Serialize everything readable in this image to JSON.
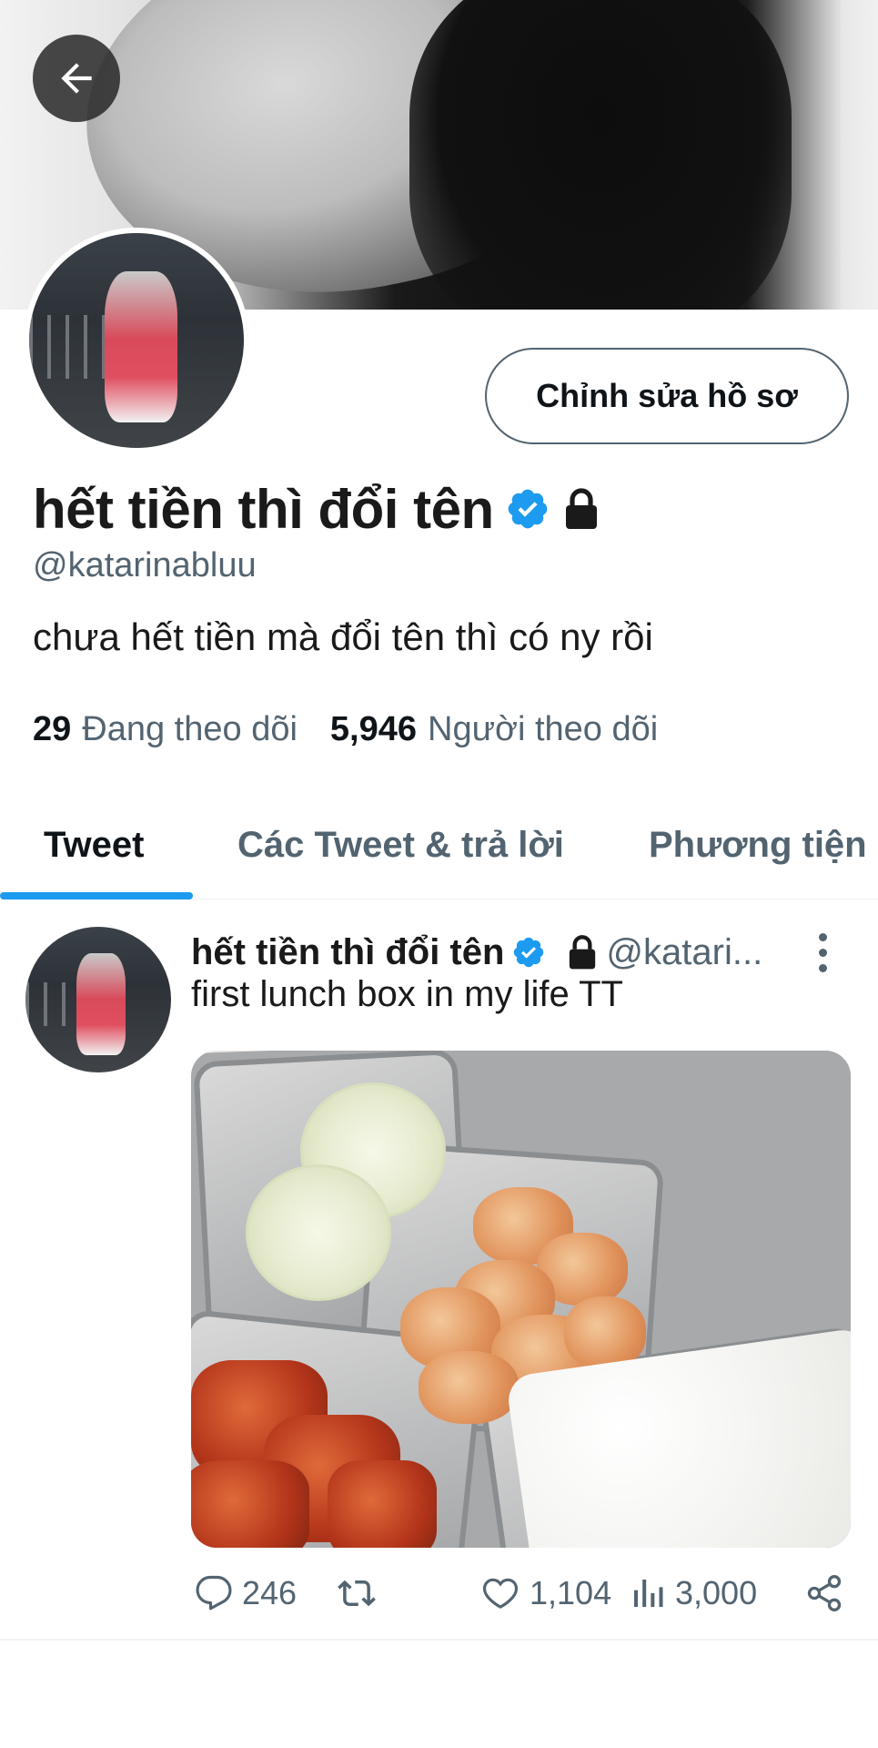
{
  "profile": {
    "display_name": "hết tiền thì đổi tên",
    "handle": "@katarinabluu",
    "bio": "chưa hết tiền mà đổi tên thì có ny rồi",
    "edit_button_label": "Chỉnh sửa hồ sơ",
    "verified": true,
    "protected": true
  },
  "stats": {
    "following_count": "29",
    "following_label": "Đang theo dõi",
    "followers_count": "5,946",
    "followers_label": "Người theo dõi"
  },
  "tabs": [
    {
      "label": "Tweet",
      "active": true
    },
    {
      "label": "Các Tweet & trả lời",
      "active": false
    },
    {
      "label": "Phương tiện",
      "active": false
    }
  ],
  "tweet": {
    "author_name": "hết tiền thì đổi tên",
    "author_handle": "@katari...",
    "text": "first lunch box in my life TT",
    "replies": "246",
    "likes": "1,104",
    "views": "3,000"
  },
  "icons": {
    "back": "arrow-left-icon",
    "verified": "verified-badge-icon",
    "protected": "lock-icon",
    "more": "more-vertical-icon",
    "reply": "reply-icon",
    "retweet": "retweet-icon",
    "like": "heart-icon",
    "views": "analytics-icon",
    "share": "share-icon"
  },
  "colors": {
    "accent": "#1d9bf0",
    "text_primary": "#0f1419",
    "text_secondary": "#536471"
  }
}
